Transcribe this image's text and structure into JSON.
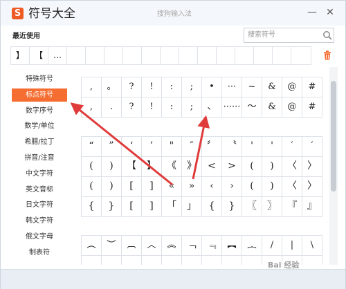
{
  "window": {
    "logo_char": "S",
    "app_title": "符号大全",
    "ime_title": "搜狗输入法",
    "minimize_glyph": "—",
    "close_glyph": "✕"
  },
  "recent": {
    "label": "最近使用",
    "items": [
      "】",
      "【",
      "…",
      "",
      "",
      "",
      "",
      "",
      "",
      "",
      "",
      "",
      "",
      "",
      "",
      ""
    ]
  },
  "search": {
    "placeholder": "搜索符号"
  },
  "sidebar": {
    "items": [
      {
        "label": "特殊符号",
        "active": false
      },
      {
        "label": "标点符号",
        "active": true
      },
      {
        "label": "数字序号",
        "active": false
      },
      {
        "label": "数学/单位",
        "active": false
      },
      {
        "label": "希腊/拉丁",
        "active": false
      },
      {
        "label": "拼音/注音",
        "active": false
      },
      {
        "label": "中文字符",
        "active": false
      },
      {
        "label": "英文音标",
        "active": false
      },
      {
        "label": "日文字符",
        "active": false
      },
      {
        "label": "韩文字符",
        "active": false
      },
      {
        "label": "俄文字母",
        "active": false
      },
      {
        "label": "制表符",
        "active": false
      }
    ]
  },
  "symbols": {
    "group1": [
      ",",
      "。",
      "?",
      "!",
      ":",
      ";",
      "•",
      "···",
      "~",
      "&",
      "@",
      "#",
      ",",
      ".",
      "?",
      "!",
      ":",
      ";",
      "、",
      "······",
      "～",
      "&",
      "@",
      "#"
    ],
    "group2": [
      "“",
      "”",
      "‘",
      "’",
      "\"",
      "″",
      "〞",
      "〝",
      "'",
      "'",
      "′",
      "′",
      "(",
      ")",
      "【",
      "】",
      "《",
      "》",
      "<",
      ">",
      "(",
      ")",
      "〈",
      "〉",
      "(",
      ")",
      "[",
      "]",
      "«",
      "»",
      "‹",
      "›",
      "(",
      ")",
      "〈",
      "〉",
      "{",
      "}",
      "[",
      "]",
      "「",
      "」",
      "{",
      "}",
      "〖",
      "〗",
      "『",
      "』"
    ],
    "group3": [
      "︵",
      "︶",
      "︹",
      "︿",
      "︽",
      "﹁",
      "﹃",
      "︻",
      "︷",
      "/",
      "|",
      "\\",
      "",
      "",
      "",
      "",
      "",
      "",
      "",
      "",
      "",
      "",
      "",
      ""
    ]
  },
  "colors": {
    "accent": "#f56d30",
    "arrow": "#e03b3b"
  },
  "watermark": "Bai 经验"
}
